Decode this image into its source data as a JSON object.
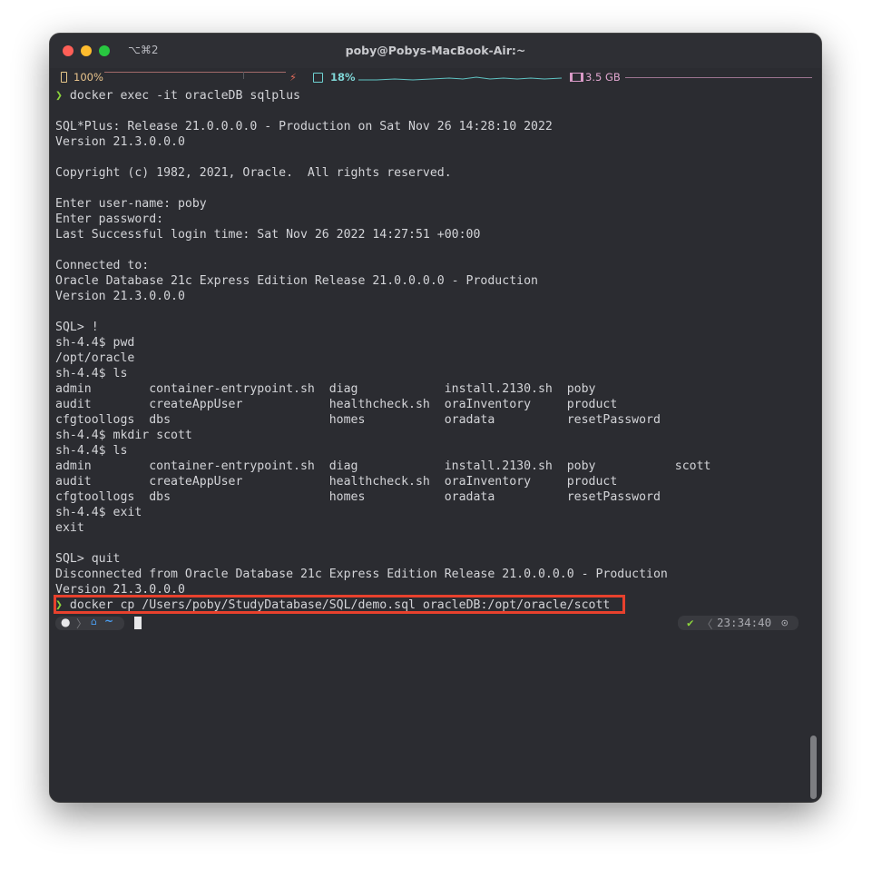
{
  "window": {
    "title": "poby@Pobys-MacBook-Air:~",
    "shortcut": "⌥⌘2"
  },
  "status": {
    "battery": "100%",
    "cpu": "18%",
    "memory": "3.5 GB"
  },
  "terminal": {
    "lines": [
      {
        "prefix": "❯ ",
        "text": "docker exec -it oracleDB sqlplus"
      },
      {
        "prefix": "",
        "text": ""
      },
      {
        "prefix": "",
        "text": "SQL*Plus: Release 21.0.0.0.0 - Production on Sat Nov 26 14:28:10 2022"
      },
      {
        "prefix": "",
        "text": "Version 21.3.0.0.0"
      },
      {
        "prefix": "",
        "text": ""
      },
      {
        "prefix": "",
        "text": "Copyright (c) 1982, 2021, Oracle.  All rights reserved."
      },
      {
        "prefix": "",
        "text": ""
      },
      {
        "prefix": "",
        "text": "Enter user-name: poby"
      },
      {
        "prefix": "",
        "text": "Enter password:"
      },
      {
        "prefix": "",
        "text": "Last Successful login time: Sat Nov 26 2022 14:27:51 +00:00"
      },
      {
        "prefix": "",
        "text": ""
      },
      {
        "prefix": "",
        "text": "Connected to:"
      },
      {
        "prefix": "",
        "text": "Oracle Database 21c Express Edition Release 21.0.0.0.0 - Production"
      },
      {
        "prefix": "",
        "text": "Version 21.3.0.0.0"
      },
      {
        "prefix": "",
        "text": ""
      },
      {
        "prefix": "",
        "text": "SQL> !"
      },
      {
        "prefix": "",
        "text": "sh-4.4$ pwd"
      },
      {
        "prefix": "",
        "text": "/opt/oracle"
      },
      {
        "prefix": "",
        "text": "sh-4.4$ ls"
      },
      {
        "prefix": "",
        "text": "admin        container-entrypoint.sh  diag            install.2130.sh  poby"
      },
      {
        "prefix": "",
        "text": "audit        createAppUser            healthcheck.sh  oraInventory     product"
      },
      {
        "prefix": "",
        "text": "cfgtoollogs  dbs                      homes           oradata          resetPassword"
      },
      {
        "prefix": "",
        "text": "sh-4.4$ mkdir scott"
      },
      {
        "prefix": "",
        "text": "sh-4.4$ ls"
      },
      {
        "prefix": "",
        "text": "admin        container-entrypoint.sh  diag            install.2130.sh  poby           scott"
      },
      {
        "prefix": "",
        "text": "audit        createAppUser            healthcheck.sh  oraInventory     product"
      },
      {
        "prefix": "",
        "text": "cfgtoollogs  dbs                      homes           oradata          resetPassword"
      },
      {
        "prefix": "",
        "text": "sh-4.4$ exit"
      },
      {
        "prefix": "",
        "text": "exit"
      },
      {
        "prefix": "",
        "text": ""
      },
      {
        "prefix": "",
        "text": "SQL> quit"
      },
      {
        "prefix": "",
        "text": "Disconnected from Oracle Database 21c Express Edition Release 21.0.0.0.0 - Production"
      },
      {
        "prefix": "",
        "text": "Version 21.3.0.0.0"
      },
      {
        "prefix": "❯ ",
        "text": "docker cp /Users/poby/StudyDatabase/SQL/demo.sql oracleDB:/opt/oracle/scott"
      }
    ]
  },
  "prompt": {
    "path": "~",
    "status_check": "✔",
    "time": "23:34:40"
  },
  "icons": {
    "apple": "apple-icon",
    "home": "home-icon",
    "clock": "clock-icon",
    "battery": "battery-icon",
    "cpu": "cpu-icon",
    "memory": "memory-icon"
  },
  "colors": {
    "background": "#2b2c31",
    "prompt_chevron": "#8cd43c",
    "highlight": "#e8412d",
    "cpu": "#7fd6d6",
    "memory": "#e0a6cf",
    "battery": "#e9c48c"
  }
}
